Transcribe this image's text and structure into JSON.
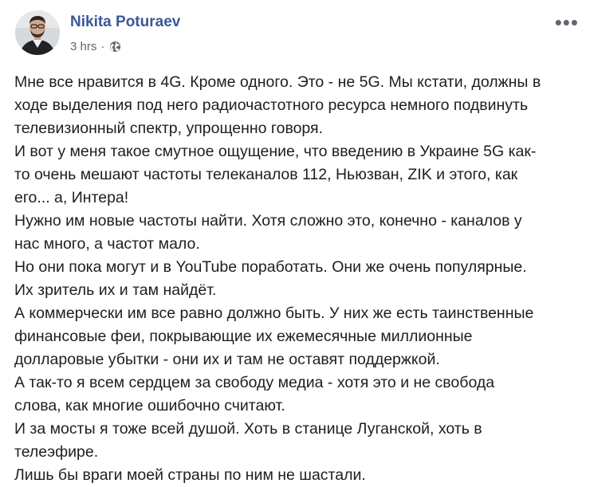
{
  "post": {
    "author": "Nikita Poturaev",
    "time": "3 hrs",
    "separator": "·",
    "privacy_icon": "globe-icon",
    "more_icon": "more-options-icon",
    "more_label": "•••",
    "lines": [
      "Мне все нравится в 4G. Кроме одного. Это - не 5G. Мы кстати, должны в",
      "ходе выделения под него радиочастотного ресурса немного подвинуть",
      "телевизионный спектр, упрощенно говоря.",
      "И вот у меня такое смутное ощущение, что введению в Украине 5G как-",
      "то очень мешают частоты телеканалов 112, Ньюзван, ZIK и этого, как",
      "его... а, Интера!",
      "Нужно им новые частоты найти. Хотя сложно это, конечно - каналов у",
      "нас много, а частот мало.",
      "Но они пока могут и в YouTube поработать. Они же очень популярные.",
      "Их зритель их и там найдёт.",
      "А коммерчески им все равно должно быть. У них же есть таинственные",
      "финансовые феи, покрывающие их ежемесячные миллионные",
      "долларовые убытки - они их и там не оставят поддержкой.",
      "А так-то я всем сердцем за свободу медиа - хотя это и не свобода",
      "слова, как многие ошибочно считают.",
      "И за мосты я тоже всей душой. Хоть в станице Луганской, хоть в",
      "телеэфире.",
      "Лишь бы враги моей страны по ним не шастали."
    ]
  },
  "colors": {
    "author": "#385898",
    "meta": "#616770",
    "text": "#1c1e21",
    "background": "#ffffff"
  }
}
